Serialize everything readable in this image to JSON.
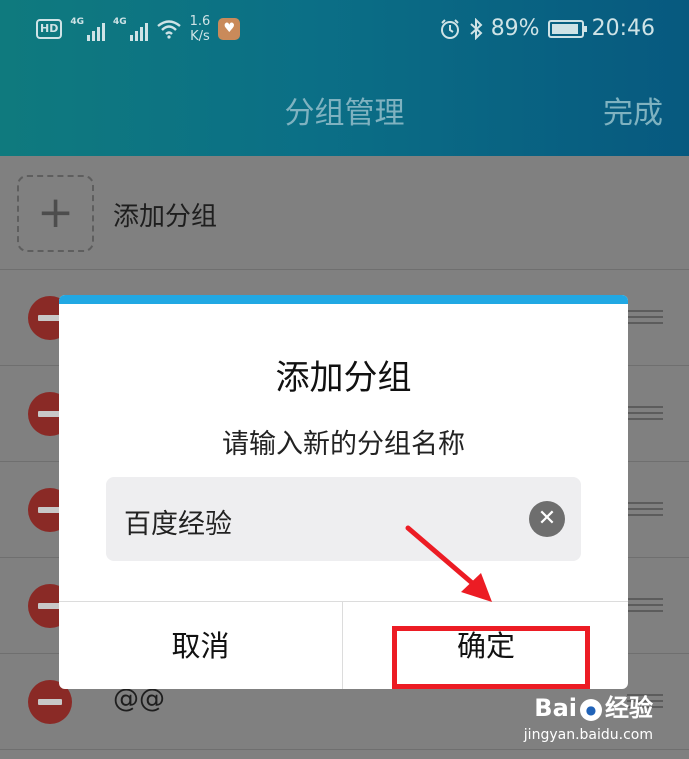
{
  "status_bar": {
    "hd": "HD",
    "sig1_label": "4G",
    "sig2_label": "4G",
    "speed_value": "1.6",
    "speed_unit": "K/s",
    "battery": "89%",
    "time": "20:46",
    "icons": [
      "alarm-icon",
      "bluetooth-icon",
      "battery-icon",
      "wifi-icon"
    ]
  },
  "header": {
    "title": "分组管理",
    "done_label": "完成"
  },
  "list": {
    "add_label": "添加分组",
    "visible_item_label": "@@"
  },
  "dialog": {
    "title": "添加分组",
    "message": "请输入新的分组名称",
    "input_value": "百度经验",
    "cancel_label": "取消",
    "confirm_label": "确定",
    "accent_color": "#21a8e3"
  },
  "annotation": {
    "color": "#ec1c24"
  },
  "watermark": {
    "brand_left": "Bai",
    "brand_right": "经验",
    "url": "jingyan.baidu.com"
  }
}
